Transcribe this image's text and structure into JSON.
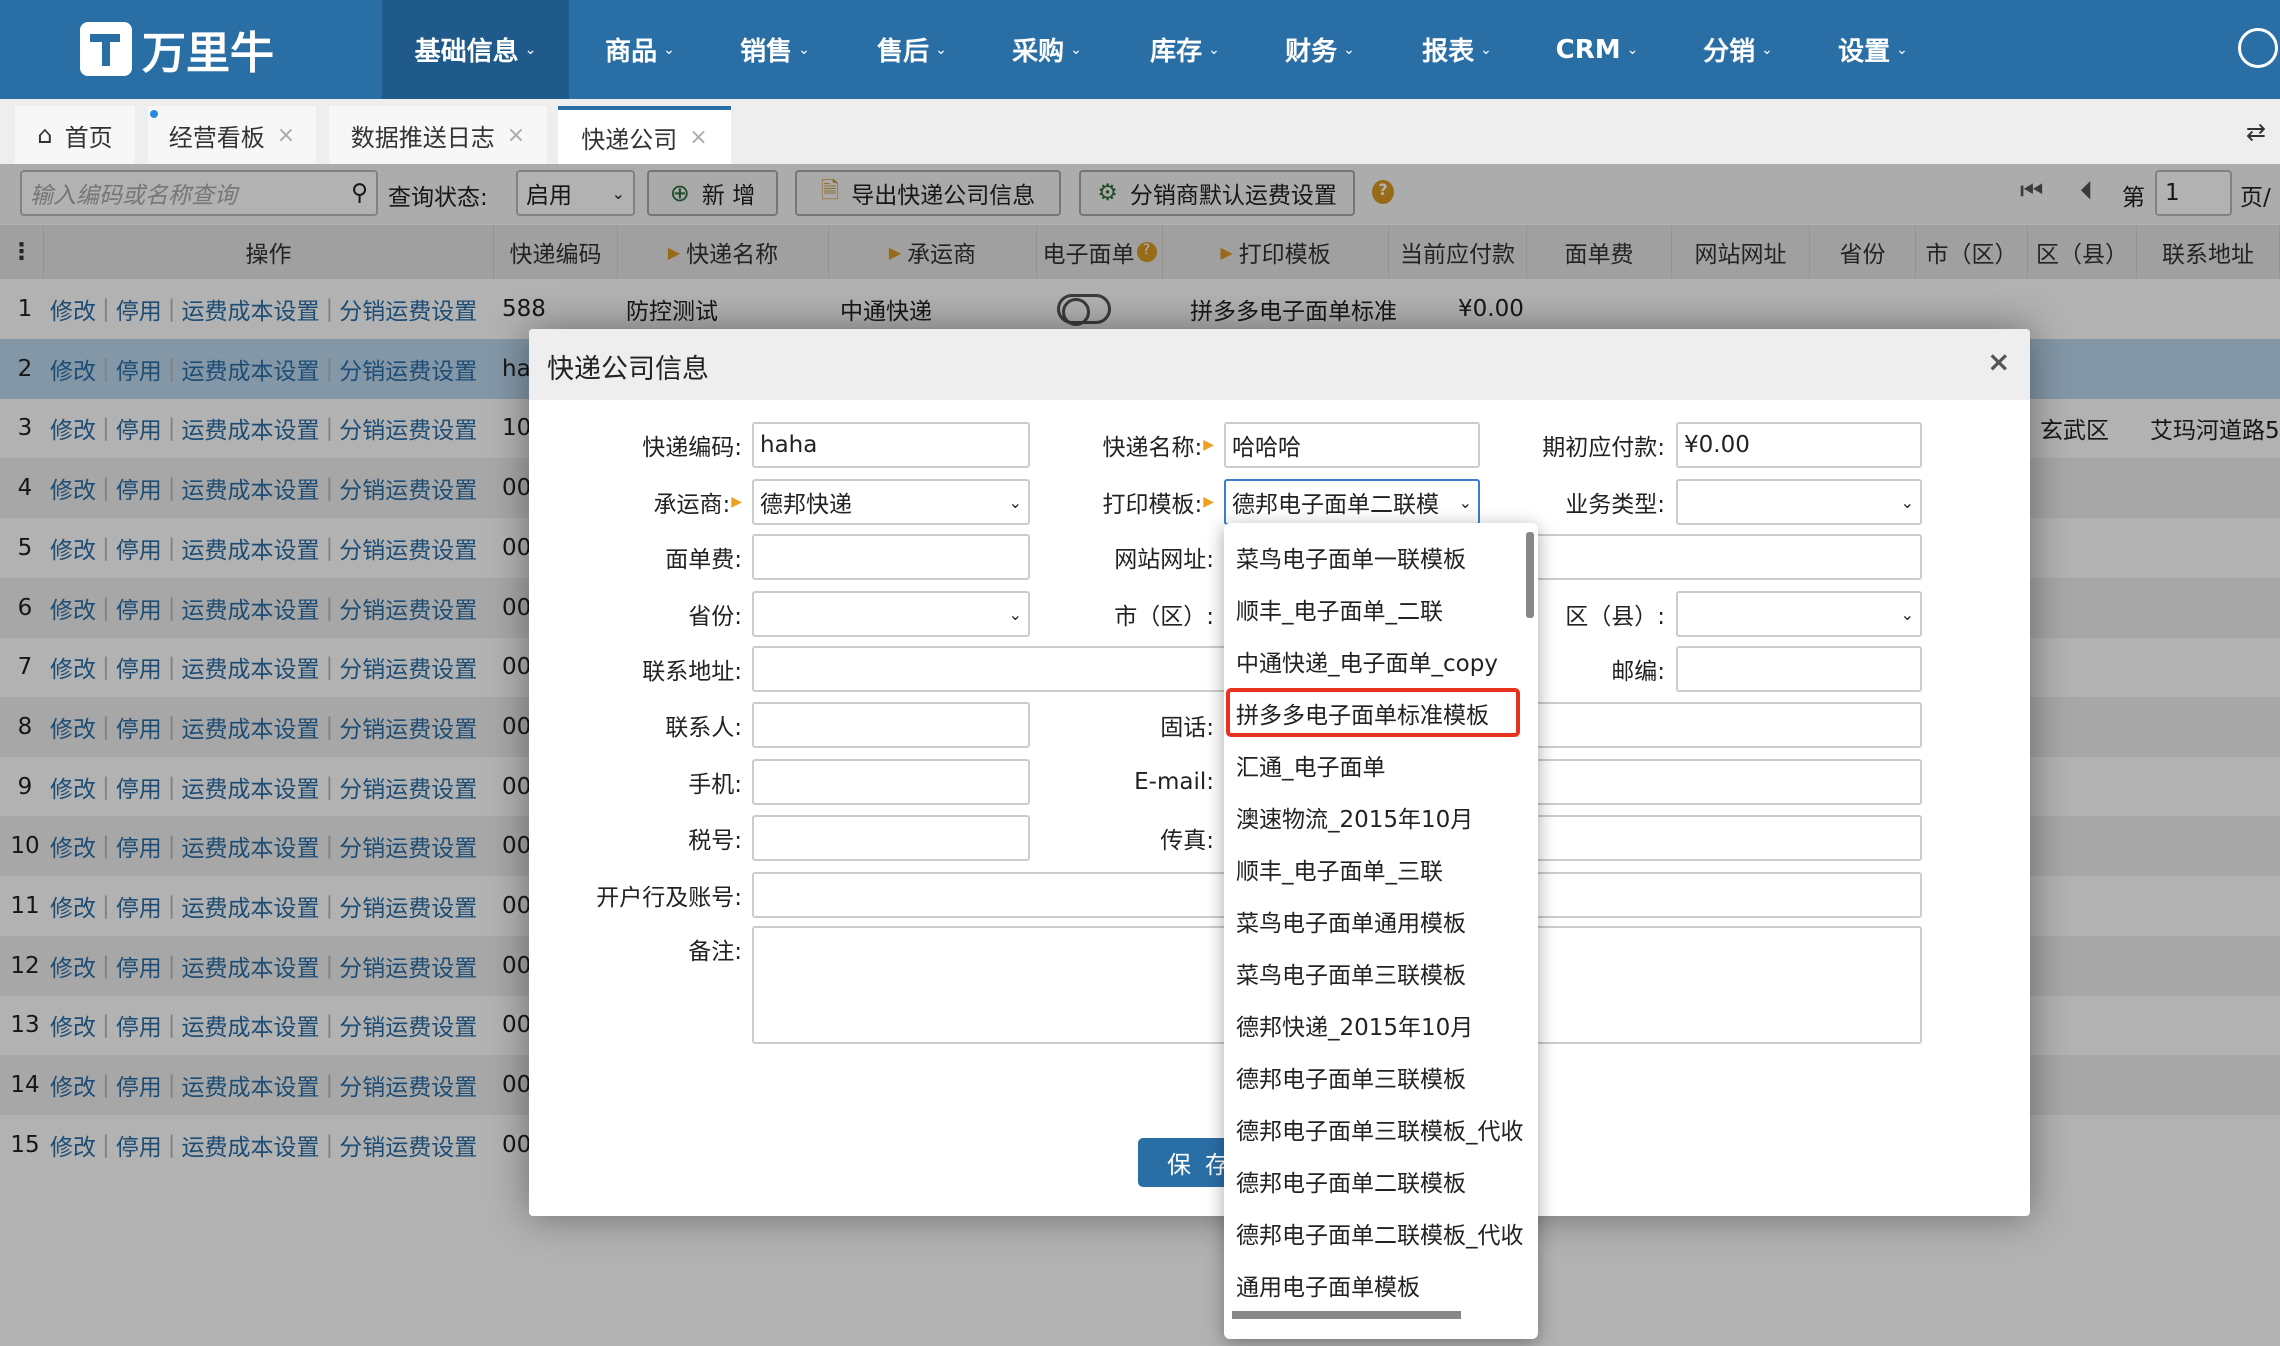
{
  "brand": {
    "name": "万里牛",
    "accent": "#2a6ea6"
  },
  "nav": [
    "基础信息",
    "商品",
    "销售",
    "售后",
    "采购",
    "库存",
    "财务",
    "报表",
    "CRM",
    "分销",
    "设置"
  ],
  "tabs": [
    {
      "label": "首页",
      "icon": "home-icon"
    },
    {
      "label": "经营看板"
    },
    {
      "label": "数据推送日志"
    },
    {
      "label": "快递公司",
      "active": true
    }
  ],
  "toolbar": {
    "search_placeholder": "输入编码或名称查询",
    "status_label": "查询状态:",
    "status_value": "启用",
    "add": "新 增",
    "export": "导出快递公司信息",
    "dist_fee": "分销商默认运费设置",
    "page_label": "第",
    "page_value": "1",
    "page_suffix": "页/"
  },
  "table": {
    "columns": [
      "操作",
      "快递编码",
      "快递名称",
      "承运商",
      "电子面单",
      "打印模板",
      "当前应付款",
      "面单费",
      "网站网址",
      "省份",
      "市（区）",
      "区（县）",
      "联系地址"
    ],
    "actions": [
      "修改",
      "停用",
      "运费成本设置",
      "分销运费设置"
    ],
    "rows": [
      {
        "no": "1",
        "code": "588",
        "name": "防控测试",
        "carrier": "中通快递",
        "template": "拼多多电子面单标准",
        "payable": "¥0.00"
      },
      {
        "no": "2",
        "code": "ha",
        "selected": true
      },
      {
        "no": "3",
        "code": "10",
        "district": "玄武区",
        "address": "艾玛河道路5"
      },
      {
        "no": "4",
        "code": "00"
      },
      {
        "no": "5",
        "code": "00"
      },
      {
        "no": "6",
        "code": "00"
      },
      {
        "no": "7",
        "code": "00"
      },
      {
        "no": "8",
        "code": "00"
      },
      {
        "no": "9",
        "code": "00"
      },
      {
        "no": "10",
        "code": "00"
      },
      {
        "no": "11",
        "code": "00"
      },
      {
        "no": "12",
        "code": "00"
      },
      {
        "no": "13",
        "code": "00"
      },
      {
        "no": "14",
        "code": "00"
      },
      {
        "no": "15",
        "code": "00"
      }
    ]
  },
  "modal": {
    "title": "快递公司信息",
    "close": "×",
    "fields": {
      "code": {
        "label": "快递编码:",
        "value": "haha"
      },
      "name": {
        "label": "快递名称:",
        "value": "哈哈哈"
      },
      "opening": {
        "label": "期初应付款:",
        "value": "¥0.00"
      },
      "carrier": {
        "label": "承运商:",
        "value": "德邦快递"
      },
      "template": {
        "label": "打印模板:",
        "value": "德邦电子面单二联模"
      },
      "biztype": {
        "label": "业务类型:",
        "value": ""
      },
      "fee": {
        "label": "面单费:",
        "value": ""
      },
      "website": {
        "label": "网站网址:",
        "value": ""
      },
      "province": {
        "label": "省份:",
        "value": ""
      },
      "city": {
        "label": "市（区）:",
        "value": ""
      },
      "county": {
        "label": "区（县）:",
        "value": ""
      },
      "address": {
        "label": "联系地址:",
        "value": ""
      },
      "zip": {
        "label": "邮编:",
        "value": ""
      },
      "contact": {
        "label": "联系人:",
        "value": ""
      },
      "phone": {
        "label": "固话:",
        "value": ""
      },
      "mobile": {
        "label": "手机:",
        "value": ""
      },
      "email": {
        "label": "E-mail:",
        "value": ""
      },
      "tax": {
        "label": "税号:",
        "value": ""
      },
      "fax": {
        "label": "传真:",
        "value": ""
      },
      "bank": {
        "label": "开户行及账号:",
        "value": ""
      },
      "remark": {
        "label": "备注:",
        "value": ""
      }
    },
    "save": "保存"
  },
  "dropdown": {
    "highlight_color": "#e8321f",
    "highlighted_index": 3,
    "options": [
      "菜鸟电子面单一联模板",
      "顺丰_电子面单_二联",
      "中通快递_电子面单_copy",
      "拼多多电子面单标准模板",
      "汇通_电子面单",
      "澳速物流_2015年10月",
      "顺丰_电子面单_三联",
      "菜鸟电子面单通用模板",
      "菜鸟电子面单三联模板",
      "德邦快递_2015年10月",
      "德邦电子面单三联模板",
      "德邦电子面单三联模板_代收",
      "德邦电子面单二联模板",
      "德邦电子面单二联模板_代收",
      "通用电子面单模板"
    ]
  }
}
